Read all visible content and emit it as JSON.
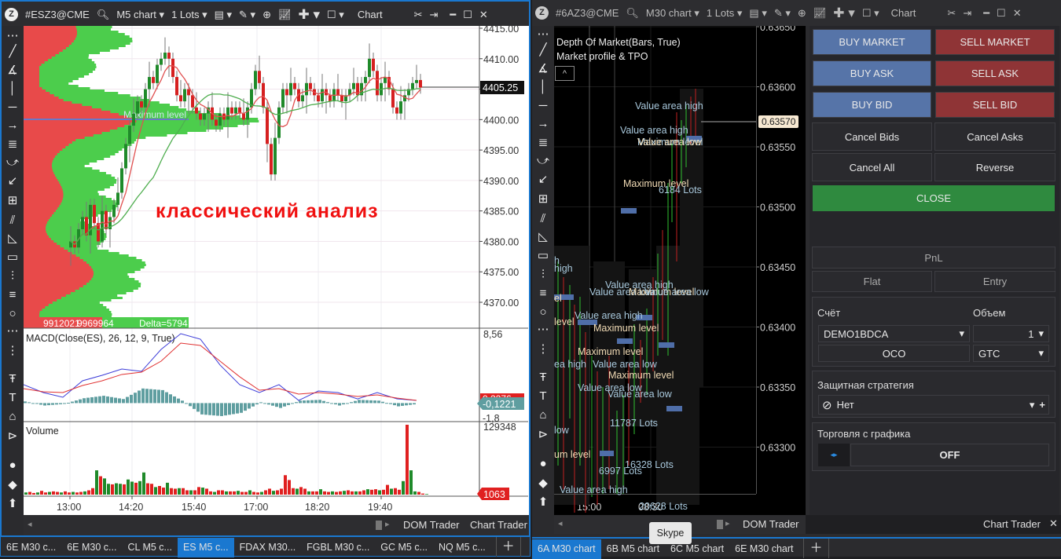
{
  "left_window": {
    "symbol": "#ESZ3@CME",
    "timeframe": "M5 chart",
    "lots": "1 Lots",
    "mode": "Chart",
    "price_ticks": [
      "4415.00",
      "4410.00",
      "4405.00",
      "4400.00",
      "4395.00",
      "4390.00",
      "4385.00",
      "4380.00",
      "4375.00",
      "4370.00"
    ],
    "last_price": "4405.25",
    "time_ticks": [
      "13:00",
      "14:20",
      "15:40",
      "17:00",
      "18:20",
      "19:40"
    ],
    "annotation": "классический анализ",
    "profile_label": "Maximum level",
    "profile_sell": "9912021",
    "profile_buy": "9969964",
    "profile_delta": "Delta=5794",
    "macd_title": "MACD(Close(ES), 26, 12, 9, True)",
    "macd_max": "8,56",
    "macd_min": "-1,8",
    "macd_signal_tag": "0,2276",
    "macd_value_tag": "-0,1221",
    "volume_title": "Volume",
    "volume_max": "129348",
    "volume_last": "1063",
    "bottom_links": [
      "DOM Trader",
      "Chart Trader"
    ],
    "closes": [
      4380,
      4379,
      4382,
      4384,
      4381,
      4386,
      4383,
      4380,
      4385,
      4382,
      4384,
      4386,
      4388,
      4392,
      4396,
      4399,
      4401,
      4403,
      4402,
      4405,
      4407,
      4406,
      4409,
      4410,
      4411,
      4410,
      4407,
      4404,
      4403,
      4405,
      4404,
      4402,
      4401,
      4400,
      4401,
      4402,
      4400,
      4399,
      4401,
      4400,
      4402,
      4401,
      4402,
      4401,
      4400,
      4402,
      4405,
      4408,
      4406,
      4402,
      4396,
      4391,
      4397,
      4402,
      4405,
      4404,
      4406,
      4405,
      4403,
      4404,
      4406,
      4405,
      4404,
      4403,
      4405,
      4404,
      4403,
      4405,
      4404,
      4403,
      4404,
      4405,
      4406,
      4404,
      4406,
      4407,
      4410,
      4408,
      4404,
      4406,
      4407,
      4405,
      4402,
      4401,
      4403,
      4404,
      4405,
      4406,
      4406.5,
      4405.25
    ],
    "volume": [
      4000,
      5000,
      3000,
      4000,
      7000,
      4000,
      5000,
      6000,
      5000,
      4000,
      6000,
      4000,
      5000,
      4000,
      5000,
      6000,
      8000,
      12000,
      45000,
      34000,
      30000,
      20000,
      19000,
      21000,
      20000,
      19000,
      28000,
      24000,
      22000,
      25000,
      41000,
      21000,
      20000,
      14000,
      16000,
      13000,
      22000,
      12000,
      11000,
      12000,
      12000,
      8000,
      8000,
      8000,
      14000,
      13000,
      11000,
      6000,
      5000,
      8000,
      8000,
      6000,
      6000,
      6000,
      7000,
      5000,
      5000,
      8000,
      5000,
      4000,
      5000,
      8000,
      11000,
      7000,
      8000,
      11000,
      36000,
      27000,
      12000,
      11000,
      14000,
      11000,
      6000,
      6000,
      6000,
      10000,
      6000,
      5000,
      6000,
      5000,
      6000,
      7000,
      8000,
      6000,
      6000,
      6000,
      8000,
      10000,
      9000,
      10000,
      8000,
      9000,
      18000,
      11000,
      12000,
      9000,
      25000,
      129348,
      45000,
      6000,
      5000,
      2000,
      1063
    ],
    "macd": [
      2.27,
      1.3,
      0.72,
      2.75,
      3.43,
      4.2,
      3.91,
      6.62,
      8.56,
      7.88,
      4.69,
      2.27,
      1.3,
      2.27,
      0.33,
      1.49,
      1.3,
      0.52,
      1.3,
      0.52,
      0.33
    ],
    "signal": [
      1.78,
      1.4,
      1.3,
      2.17,
      2.75,
      3.53,
      3.82,
      5.17,
      7.4,
      7.11,
      5.17,
      3.24,
      1.59,
      1.78,
      1.11,
      1.3,
      1.11,
      0.82,
      1.01,
      0.62,
      0.33
    ],
    "histogram": [
      0.2,
      -0.3,
      -0.1,
      0.6,
      0.9,
      0.5,
      1.8,
      1.6,
      0.3,
      -1.4,
      -1.6,
      -1.2,
      0.1,
      -0.6,
      0.3,
      0.4,
      -0.3,
      0.4,
      0.3,
      -0.4,
      -0.1
    ]
  },
  "right_window": {
    "symbol": "#6AZ3@CME",
    "timeframe": "M30 chart",
    "lots": "1 Lots",
    "mode": "Chart",
    "indicators": [
      "Depth Of Market(Bars, True)",
      "Market profile & TPO"
    ],
    "price_ticks": [
      "0.63650",
      "0.63600",
      "0.63550",
      "0.63500",
      "0.63450",
      "0.63400",
      "0.63350",
      "0.63300"
    ],
    "last_price": "0.63570",
    "time_ticks": [
      "15:00",
      "08:30"
    ],
    "labels": [
      "Value area high",
      "Value area high",
      "Maximum level",
      "Value area low",
      "Maximum level",
      "6184 Lots",
      "h",
      "high",
      "Value area high",
      "Value area low",
      "Maximum level",
      "Value area low",
      "el",
      "Value area high",
      "level",
      "Maximum level",
      "Maximum level",
      "ea high",
      "Value area low",
      "Maximum level",
      "Value area low",
      "Value area low",
      "11787 Lots",
      "low",
      "um level",
      "16328 Lots",
      "6997 Lots",
      "Value area high",
      "20628 Lots"
    ],
    "bottom_links": [
      "DOM Trader",
      "Chart Trader"
    ]
  },
  "trader": {
    "buy_market": "BUY MARKET",
    "sell_market": "SELL MARKET",
    "buy_ask": "BUY ASK",
    "sell_ask": "SELL ASK",
    "buy_bid": "BUY BID",
    "sell_bid": "SELL BID",
    "cancel_bids": "Cancel Bids",
    "cancel_asks": "Cancel Asks",
    "cancel_all": "Cancel All",
    "reverse": "Reverse",
    "close": "CLOSE",
    "pnl": "PnL",
    "flat": "Flat",
    "entry": "Entry",
    "account_label": "Счёт",
    "account": "DEMO1BDCA",
    "volume_label": "Объем",
    "volume": "1",
    "oco": "OCO",
    "tif": "GTC",
    "strategy_label": "Защитная стратегия",
    "strategy": "Нет",
    "chart_trading_label": "Торговля с графика",
    "chart_trading": "OFF",
    "colors": {
      "buy": "#5674a8",
      "sell": "#8f3436",
      "close": "#2f8a3f"
    }
  },
  "tabs_left": [
    {
      "label": "6E M30 c..."
    },
    {
      "label": "6E M30 c..."
    },
    {
      "label": "CL M5 c..."
    },
    {
      "label": "ES M5 c...",
      "active": true
    },
    {
      "label": "FDAX M30..."
    },
    {
      "label": "FGBL M30 c..."
    },
    {
      "label": "GC M5 c..."
    },
    {
      "label": "NQ M5 c..."
    }
  ],
  "tabs_right": [
    {
      "label": "6A M30 chart",
      "active": true
    },
    {
      "label": "6B M5 chart"
    },
    {
      "label": "6C M5 chart"
    },
    {
      "label": "6E M30 chart"
    }
  ],
  "tooltip": "Skype"
}
